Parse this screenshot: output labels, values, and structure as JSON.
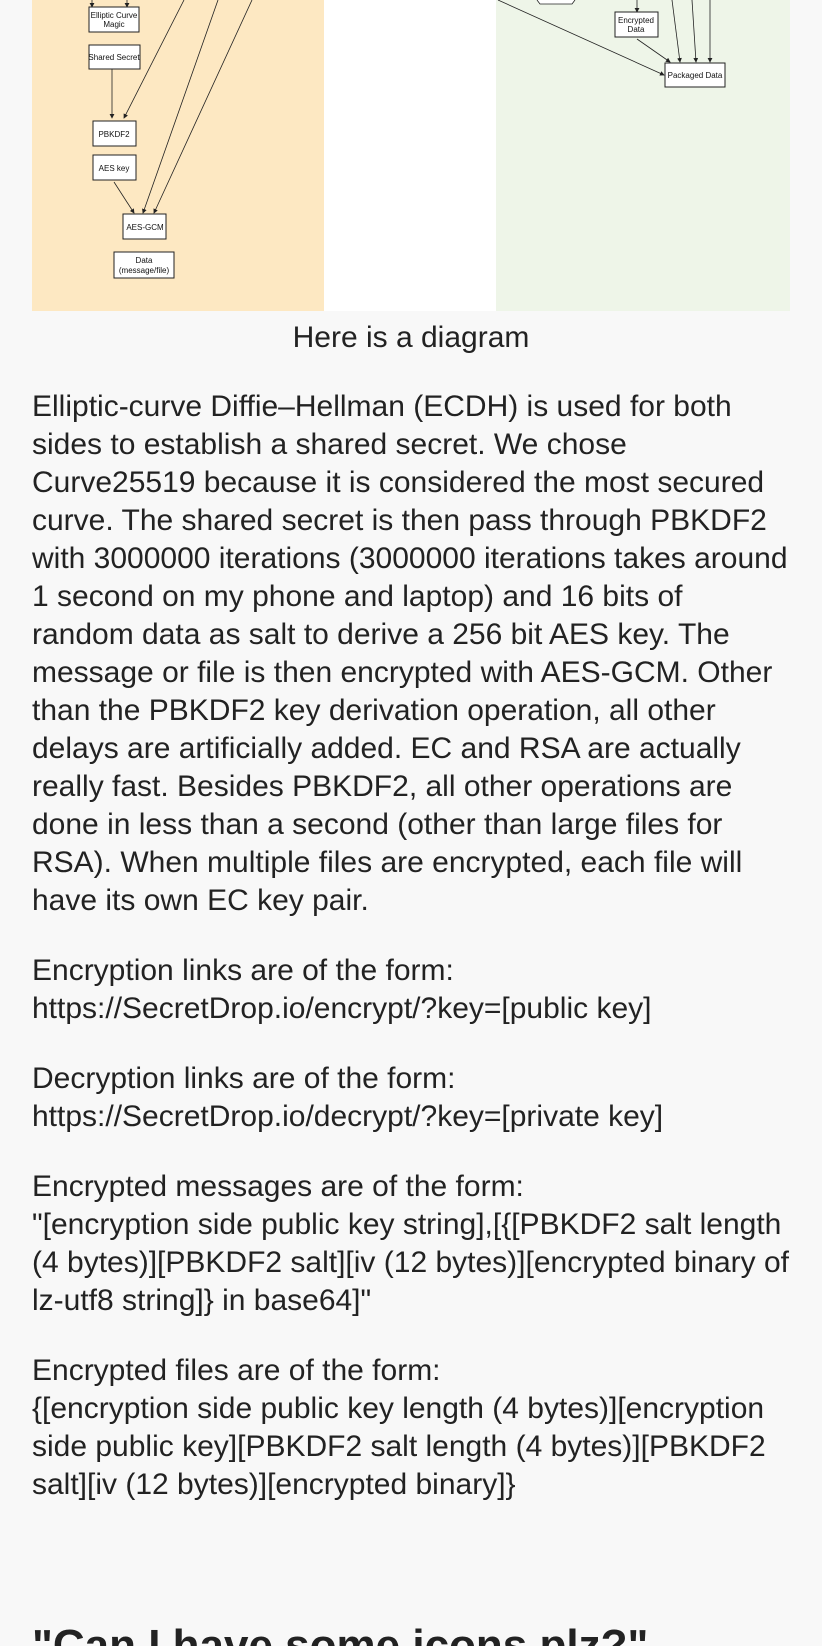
{
  "diagram": {
    "colors": {
      "left_panel": "#fde8c2",
      "right_panel": "#eef5e8",
      "middle_panel": "#ffffff"
    },
    "left_nodes": {
      "ec_magic_line1": "Elliptic Curve",
      "ec_magic_line2": "Magic",
      "shared_secret": "Shared Secret",
      "pbkdf2": "PBKDF2",
      "aes_key": "AES key",
      "aes_gcm": "AES-GCM",
      "data_line1": "Data",
      "data_line2": "(message/file)"
    },
    "right_nodes": {
      "encrypted_data_line1": "Encrypted",
      "encrypted_data_line2": "Data",
      "packaged_data": "Packaged Data"
    }
  },
  "caption": "Here is a diagram",
  "paragraphs": {
    "ecdh": "Elliptic-curve Diffie–Hellman (ECDH) is used for both sides to establish a shared secret. We chose Curve25519 because it is considered the most secured curve. The shared secret is then pass through PBKDF2 with 3000000 iterations (3000000 iterations takes around 1 second on my phone and laptop) and 16 bits of random data as salt to derive a 256 bit AES key. The message or file is then encrypted with AES-GCM. Other than the PBKDF2 key derivation operation, all other delays are artificially added. EC and RSA are actually really fast. Besides PBKDF2, all other operations are done in less than a second (other than large files for RSA). When multiple files are encrypted, each file will have its own EC key pair.",
    "encryption_links_label": "Encryption links are of the form:",
    "encryption_links_value": "https://SecretDrop.io/encrypt/?key=[public key]",
    "decryption_links_label": "Decryption links are of the form:",
    "decryption_links_value": "https://SecretDrop.io/decrypt/?key=[private key]",
    "encrypted_messages_label": "Encrypted messages are of the form:",
    "encrypted_messages_value": "\"[encryption side public key string],[{[PBKDF2 salt length (4 bytes)][PBKDF2 salt][iv (12 bytes)][encrypted binary of lz-utf8 string]} in base64]\"",
    "encrypted_files_label": "Encrypted files are of the form:",
    "encrypted_files_value": "{[encryption side public key length (4 bytes)][encryption side public key][PBKDF2 salt length (4 bytes)][PBKDF2 salt][iv (12 bytes)][encrypted binary]}"
  },
  "next_heading": "\"Can I have some icons plz?\""
}
